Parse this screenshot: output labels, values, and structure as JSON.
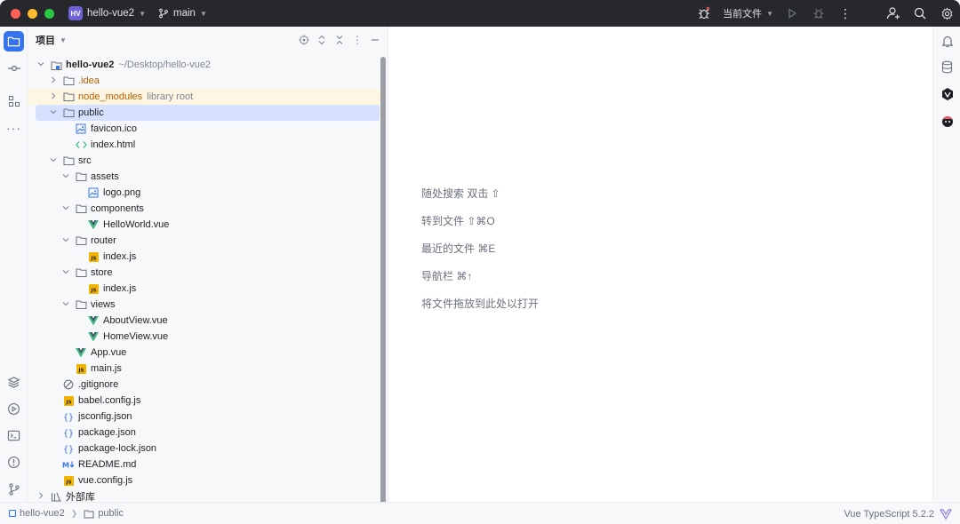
{
  "titlebar": {
    "project_badge": "HV",
    "project_name": "hello-vue2",
    "branch": "main",
    "run_config": "当前文件"
  },
  "left_strip": [
    {
      "name": "project-icon",
      "active": true
    },
    {
      "name": "commit-icon"
    },
    {
      "name": "structure-icon"
    },
    {
      "name": "more-icon"
    },
    {
      "name": "layers-icon"
    },
    {
      "name": "run-icon"
    },
    {
      "name": "terminal-icon"
    },
    {
      "name": "problems-icon"
    },
    {
      "name": "git-icon"
    }
  ],
  "panel": {
    "title": "项目"
  },
  "tree": [
    {
      "depth": 0,
      "chev": "down",
      "icon": "module",
      "label": "hello-vue2",
      "hint": "~/Desktop/hello-vue2",
      "bold": true
    },
    {
      "depth": 1,
      "chev": "right",
      "icon": "folder",
      "label": ".idea",
      "orange": true
    },
    {
      "depth": 1,
      "chev": "right",
      "icon": "folder",
      "label": "node_modules",
      "hint": "library root",
      "orange": true,
      "hl": true
    },
    {
      "depth": 1,
      "chev": "down",
      "icon": "folder",
      "label": "public",
      "sel": true
    },
    {
      "depth": 2,
      "icon": "image",
      "label": "favicon.ico"
    },
    {
      "depth": 2,
      "icon": "html",
      "label": "index.html"
    },
    {
      "depth": 1,
      "chev": "down",
      "icon": "folder",
      "label": "src"
    },
    {
      "depth": 2,
      "chev": "down",
      "icon": "folder",
      "label": "assets"
    },
    {
      "depth": 3,
      "icon": "image",
      "label": "logo.png"
    },
    {
      "depth": 2,
      "chev": "down",
      "icon": "folder",
      "label": "components"
    },
    {
      "depth": 3,
      "icon": "vue",
      "label": "HelloWorld.vue"
    },
    {
      "depth": 2,
      "chev": "down",
      "icon": "folder",
      "label": "router"
    },
    {
      "depth": 3,
      "icon": "js",
      "label": "index.js"
    },
    {
      "depth": 2,
      "chev": "down",
      "icon": "folder",
      "label": "store"
    },
    {
      "depth": 3,
      "icon": "js",
      "label": "index.js"
    },
    {
      "depth": 2,
      "chev": "down",
      "icon": "folder",
      "label": "views"
    },
    {
      "depth": 3,
      "icon": "vue",
      "label": "AboutView.vue"
    },
    {
      "depth": 3,
      "icon": "vue",
      "label": "HomeView.vue"
    },
    {
      "depth": 2,
      "icon": "vue",
      "label": "App.vue"
    },
    {
      "depth": 2,
      "icon": "js",
      "label": "main.js"
    },
    {
      "depth": 1,
      "icon": "ignore",
      "label": ".gitignore"
    },
    {
      "depth": 1,
      "icon": "js",
      "label": "babel.config.js"
    },
    {
      "depth": 1,
      "icon": "json",
      "label": "jsconfig.json"
    },
    {
      "depth": 1,
      "icon": "json",
      "label": "package.json"
    },
    {
      "depth": 1,
      "icon": "json",
      "label": "package-lock.json"
    },
    {
      "depth": 1,
      "icon": "md",
      "label": "README.md"
    },
    {
      "depth": 1,
      "icon": "js",
      "label": "vue.config.js"
    },
    {
      "depth": 0,
      "chev": "right",
      "icon": "library",
      "label": "外部库"
    }
  ],
  "editor": {
    "hints": [
      "随处搜索 双击 ⇧",
      "转到文件 ⇧⌘O",
      "最近的文件 ⌘E",
      "导航栏 ⌘↑",
      "将文件拖放到此处以打开"
    ]
  },
  "right_strip": [
    {
      "name": "notifications-icon"
    },
    {
      "name": "database-icon"
    },
    {
      "name": "ai-assistant-icon"
    },
    {
      "name": "plugin-icon"
    }
  ],
  "status": {
    "crumb_project": "hello-vue2",
    "crumb_folder": "public",
    "language": "Vue TypeScript 5.2.2"
  },
  "colors": {
    "accent": "#3574f0",
    "vue_green": "#41b883",
    "js_yellow": "#f0b400",
    "selection": "#d5e1ff",
    "library_orange": "#b35e00"
  }
}
